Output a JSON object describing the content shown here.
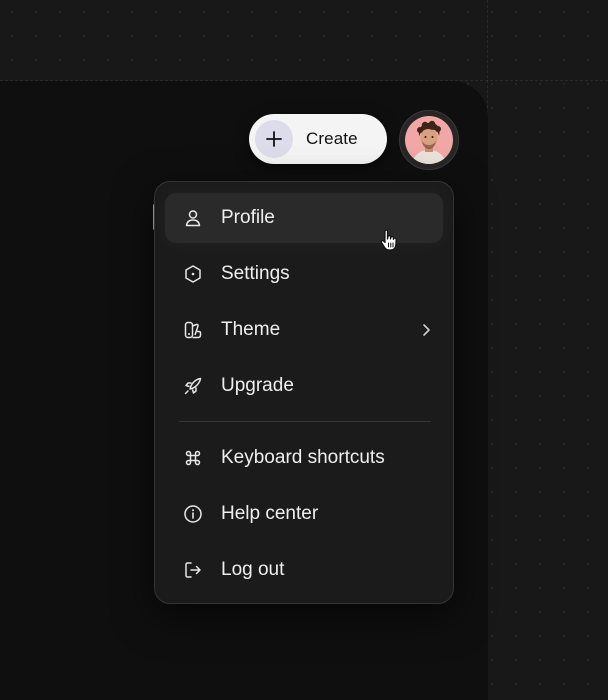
{
  "header": {
    "create_label": "Create",
    "create_icon": "plus-icon",
    "avatar_icon": "user-avatar"
  },
  "menu": {
    "items": [
      {
        "label": "Profile",
        "icon": "user-icon",
        "active": true
      },
      {
        "label": "Settings",
        "icon": "hexagon-settings-icon"
      },
      {
        "label": "Theme",
        "icon": "theme-swatch-icon",
        "has_submenu": true
      },
      {
        "label": "Upgrade",
        "icon": "rocket-icon"
      },
      {
        "label": "Keyboard shortcuts",
        "icon": "command-icon"
      },
      {
        "label": "Help center",
        "icon": "info-icon"
      },
      {
        "label": "Log out",
        "icon": "logout-icon"
      }
    ]
  },
  "colors": {
    "background": "#181818",
    "panel": "#0f0f0f",
    "menu_bg": "#1b1b1b",
    "active_item": "#2a2a2a",
    "create_button": "#f4f4f4",
    "avatar_bg": "#f2a7a7"
  }
}
